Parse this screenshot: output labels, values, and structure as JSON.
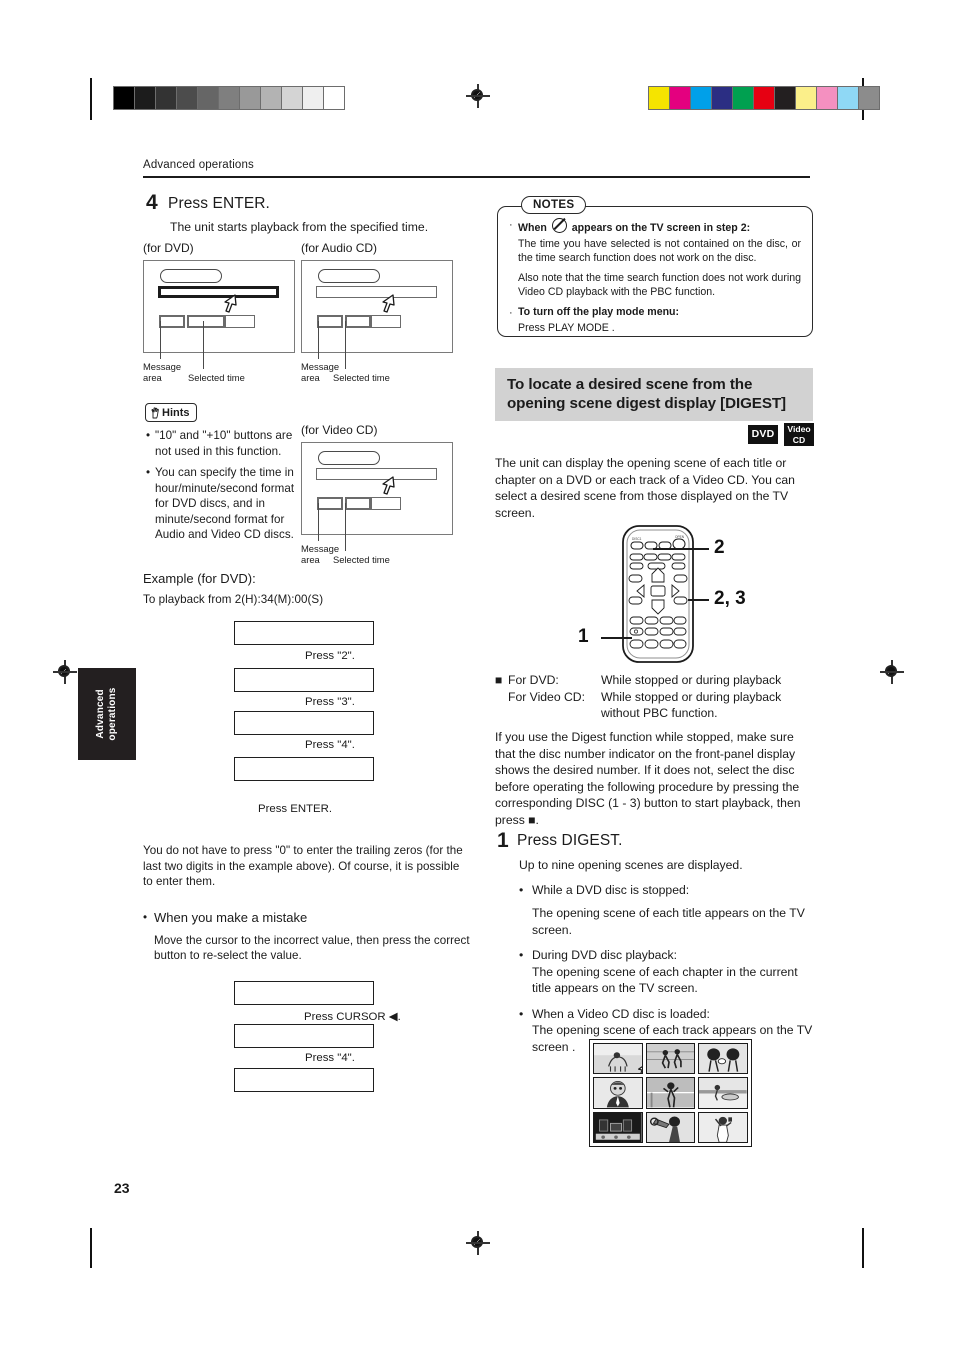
{
  "page": {
    "running_head": "Advanced operations",
    "page_number": "23",
    "side_tab": "Advanced\noperations"
  },
  "print_marks": {
    "gray_wedge": [
      "#000000",
      "#1c1c1c",
      "#333333",
      "#4c4c4c",
      "#666666",
      "#7f7f7f",
      "#999999",
      "#b3b3b3",
      "#d4d4d4",
      "#efefef",
      "#ffffff"
    ],
    "color_bars": [
      "#f5e400",
      "#e4007f",
      "#00a0e9",
      "#2b2e83",
      "#00a050",
      "#e60012",
      "#231f20",
      "#fbef8a",
      "#f490c0",
      "#8fd8f5",
      "#8c8c8c"
    ]
  },
  "left_column": {
    "step4": {
      "number": "4",
      "title": "Press ENTER.",
      "body": "The unit starts playback from the specified time."
    },
    "screens": [
      {
        "label": "(for DVD)",
        "message_caption": "Message\narea",
        "time_caption": "Selected time"
      },
      {
        "label": "(for Audio CD)",
        "message_caption": "Message\narea",
        "time_caption": "Selected time"
      },
      {
        "label": "(for Video CD)",
        "message_caption": "Message\narea",
        "time_caption": "Selected time"
      }
    ],
    "hints": {
      "label": "Hints",
      "items": [
        "\"10\" and \"+10\" buttons are not used in this function.",
        "You can specify the time in hour/minute/second format for DVD discs, and in minute/second format for Audio and Video CD discs."
      ]
    },
    "example": {
      "title": "Example (for DVD):",
      "subtitle": "To playback from 2(H):34(M):00(S)",
      "steps": [
        "Press \"2\".",
        "Press \"3\".",
        "Press \"4\".",
        "Press ENTER."
      ]
    },
    "trailing_zero_note": "You do not have to press \"0\" to enter the trailing zeros (for the last two digits in the example above). Of course, it is possible to enter them.",
    "mistake": {
      "heading": "When you make a mistake",
      "body": "Move the cursor to the incorrect value, then press the correct button to re-select the value.",
      "steps": [
        "Press CURSOR ◀.",
        "Press \"4\"."
      ]
    }
  },
  "right_column": {
    "notes": {
      "title": "NOTES",
      "items": [
        {
          "lead": "When",
          "lead_icon": "no-entry-icon",
          "lead_tail": "appears on the TV screen in step 2:",
          "paragraphs": [
            "The time you have selected is not contained on the disc, or the time search function does not work on the disc.",
            "Also note that the time search function does not work during Video CD playback with the PBC function."
          ]
        },
        {
          "lead": "To turn off the play mode menu:",
          "paragraphs": [
            "Press PLAY MODE ."
          ]
        }
      ]
    },
    "section": {
      "heading": "To locate a desired scene from the opening scene digest display [DIGEST]",
      "badges": [
        {
          "name": "dvd-badge",
          "line1": "DVD"
        },
        {
          "name": "video-cd-badge",
          "line1": "Video",
          "line2": "CD"
        }
      ],
      "intro": "The unit can display the opening scene of each title or chapter on a DVD or each track of a Video CD.  You can select a desired scene from those displayed on the TV screen."
    },
    "remote": {
      "callouts": [
        "2",
        "2, 3",
        "1"
      ]
    },
    "conditions": {
      "bullet": "■",
      "rows": [
        {
          "label": "For DVD:",
          "value": "While stopped or during playback"
        },
        {
          "label": "For Video CD:",
          "value": "While stopped or during playback"
        },
        {
          "label": "",
          "value": "without PBC function."
        }
      ]
    },
    "disc_note": "If you use the Digest function while stopped, make sure that the disc number indicator on the front-panel display shows the desired number. If it does not, select the disc before operating the following procedure by pressing the corresponding DISC (1 - 3) button to start playback, then press ■.",
    "step1": {
      "number": "1",
      "title": "Press DIGEST.",
      "body": "Up to nine opening scenes are displayed.",
      "bullets": [
        {
          "head": " While a DVD disc is stopped:",
          "sub": "The opening scene of each title appears on the TV screen."
        },
        {
          "head": "During DVD disc playback:",
          "sub": "The opening scene of each chapter in the current title appears on the TV screen."
        },
        {
          "head": "When a Video CD disc is loaded:",
          "sub": "The opening scene of each track appears on the TV screen ."
        }
      ]
    },
    "digest_grid": {
      "scenes": [
        "dog-scene",
        "soccer-scene",
        "table-tennis-scene",
        "man-portrait-scene",
        "volleyball-scene",
        "beach-scene",
        "stage-scene",
        "trumpet-scene",
        "singer-scene"
      ]
    }
  }
}
